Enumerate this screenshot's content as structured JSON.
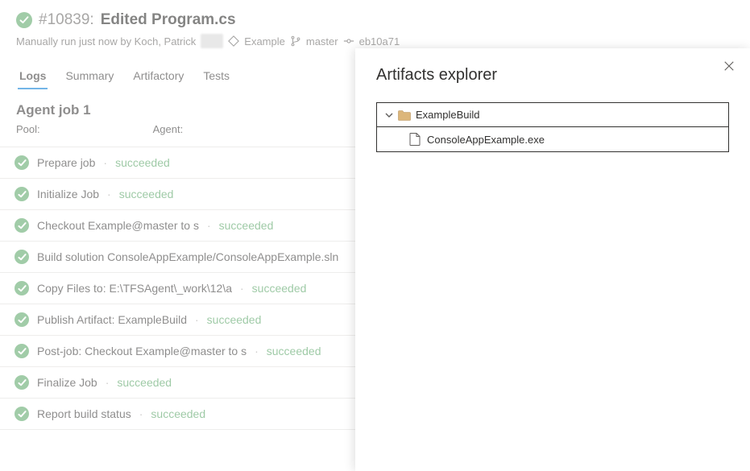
{
  "header": {
    "build_number": "#10839:",
    "title": "Edited Program.cs",
    "meta_prefix": "Manually run just now by Koch, Patrick",
    "repo": "Example",
    "branch": "master",
    "commit": "eb10a71"
  },
  "tabs": [
    {
      "label": "Logs",
      "active": true
    },
    {
      "label": "Summary",
      "active": false
    },
    {
      "label": "Artifactory",
      "active": false
    },
    {
      "label": "Tests",
      "active": false
    }
  ],
  "job": {
    "title": "Agent job 1",
    "pool_label": "Pool:",
    "agent_label": "Agent:"
  },
  "steps": [
    {
      "name": "Prepare job",
      "result": "succeeded",
      "show_result": true
    },
    {
      "name": "Initialize Job",
      "result": "succeeded",
      "show_result": true
    },
    {
      "name": "Checkout Example@master to s",
      "result": "succeeded",
      "show_result": true
    },
    {
      "name": "Build solution ConsoleAppExample/ConsoleAppExample.sln",
      "result": "succeeded",
      "show_result": false
    },
    {
      "name": "Copy Files to: E:\\TFSAgent\\_work\\12\\a",
      "result": "succeeded",
      "show_result": true
    },
    {
      "name": "Publish Artifact: ExampleBuild",
      "result": "succeeded",
      "show_result": true
    },
    {
      "name": "Post-job: Checkout Example@master to s",
      "result": "succeeded",
      "show_result": true
    },
    {
      "name": "Finalize Job",
      "result": "succeeded",
      "show_result": true
    },
    {
      "name": "Report build status",
      "result": "succeeded",
      "show_result": true
    }
  ],
  "panel": {
    "title": "Artifacts explorer",
    "root_name": "ExampleBuild",
    "children": [
      {
        "name": "ConsoleAppExample.exe"
      }
    ]
  },
  "colors": {
    "success": "#55a362",
    "accent": "#0078d4",
    "folder": "#dcb67a"
  }
}
